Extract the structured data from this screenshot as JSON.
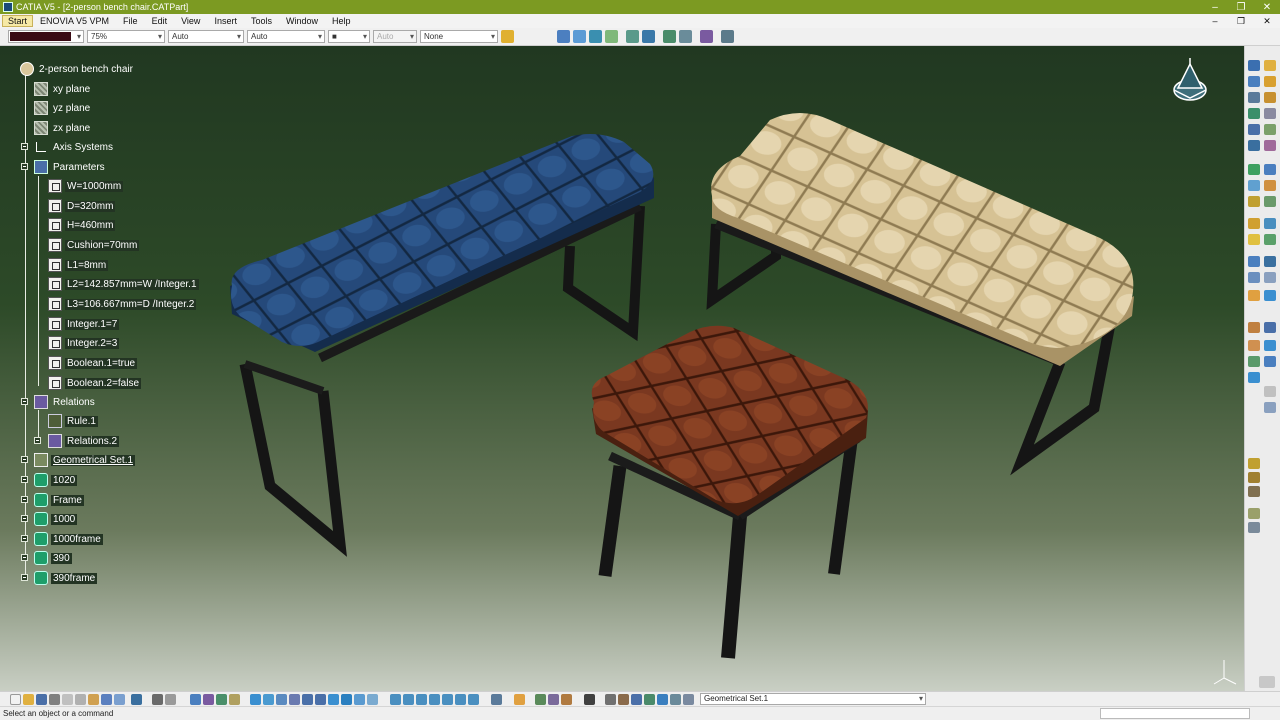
{
  "window": {
    "title": "CATIA V5 - [2-person bench chair.CATPart]",
    "controls": [
      "–",
      "❐",
      "✕"
    ]
  },
  "menu": {
    "items": [
      "Start",
      "ENOVIA V5 VPM",
      "File",
      "Edit",
      "View",
      "Insert",
      "Tools",
      "Window",
      "Help"
    ],
    "doc_controls": [
      "–",
      "❐",
      "✕"
    ]
  },
  "properties": {
    "color_value": "#3a0a14",
    "transparency": "75%",
    "line_thickness": "Auto",
    "line_type": "Auto",
    "point_symbol": "■",
    "render_style": "Auto",
    "layer": "None"
  },
  "tree": {
    "root": "2-person bench chair",
    "planes": [
      "xy plane",
      "yz plane",
      "zx plane"
    ],
    "axis_systems": "Axis Systems",
    "parameters_label": "Parameters",
    "parameters": [
      "W=1000mm",
      "D=320mm",
      "H=460mm",
      "Cushion=70mm",
      "L1=8mm",
      "L2=142.857mm=W /Integer.1",
      "L3=106.667mm=D /Integer.2",
      "Integer.1=7",
      "Integer.2=3",
      "Boolean.1=true",
      "Boolean.2=false"
    ],
    "relations_label": "Relations",
    "relations": [
      "Rule.1",
      "Relations.2"
    ],
    "geometrical_set": "Geometrical Set.1",
    "bodies": [
      "1020",
      "Frame",
      "1000",
      "1000frame",
      "390",
      "390frame"
    ]
  },
  "colors": {
    "bench_blue": "#1f3f66",
    "bench_beige": "#d9c79c",
    "stool_brown": "#6a2f1a",
    "frame_black": "#151515",
    "viewport_top": "#213821",
    "title_bar": "#7c9a22"
  },
  "bottom_toolbar": {
    "current_set": "Geometrical Set.1"
  },
  "status": {
    "message": "Select an object or a command"
  }
}
